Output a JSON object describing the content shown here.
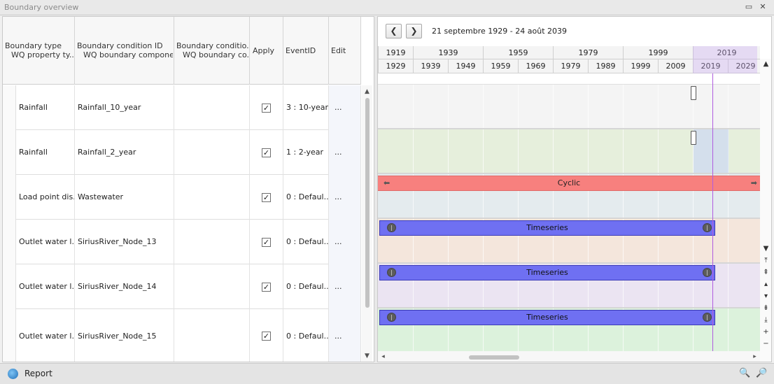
{
  "window": {
    "title": "Boundary overview",
    "restore_glyph": "▭",
    "close_glyph": "✕"
  },
  "grid": {
    "columns": [
      {
        "line1": "Boundary type",
        "line2": "WQ property ty..."
      },
      {
        "line1": "Boundary condition ID",
        "line2": "WQ boundary compone..."
      },
      {
        "line1": "Boundary conditio...",
        "line2": "WQ boundary co..."
      },
      {
        "line1": "Apply",
        "line2": ""
      },
      {
        "line1": "EventID",
        "line2": ""
      },
      {
        "line1": "Edit",
        "line2": ""
      }
    ],
    "rows": [
      {
        "type": "Rainfall",
        "id": "Rainfall_10_year",
        "cond": "",
        "apply": true,
        "event": "3 : 10-year",
        "edit": "..."
      },
      {
        "type": "Rainfall",
        "id": "Rainfall_2_year",
        "cond": "",
        "apply": true,
        "event": "1 : 2-year",
        "edit": "..."
      },
      {
        "type": "Load point dis...",
        "id": "Wastewater",
        "cond": "",
        "apply": true,
        "event": "0 : Defaul...",
        "edit": "..."
      },
      {
        "type": "Outlet water l...",
        "id": "SiriusRiver_Node_13",
        "cond": "",
        "apply": true,
        "event": "0 : Defaul...",
        "edit": "..."
      },
      {
        "type": "Outlet water l...",
        "id": "SiriusRiver_Node_14",
        "cond": "",
        "apply": true,
        "event": "0 : Defaul...",
        "edit": "..."
      },
      {
        "type": "Outlet water l...",
        "id": "SiriusRiver_Node_15",
        "cond": "",
        "apply": true,
        "event": "0 : Defaul...",
        "edit": "..."
      }
    ]
  },
  "timeline": {
    "prev_icon": "chevron-left",
    "next_icon": "chevron-right",
    "range_label": "21 septembre 1929 - 24 août 2039",
    "major_ticks": [
      "1919",
      "1939",
      "1959",
      "1979",
      "1999",
      "2019"
    ],
    "minor_ticks": [
      "1929",
      "1939",
      "1949",
      "1959",
      "1969",
      "1979",
      "1989",
      "1999",
      "2009",
      "2019",
      "2029"
    ],
    "bars": {
      "cyclic_label": "Cyclic",
      "timeseries_label": "Timeseries"
    },
    "lane_colors": [
      "#f4f4f4",
      "#e6efdc",
      "#e4ebee",
      "#f4e6dc",
      "#ebe4f2",
      "#dcf2dc"
    ]
  },
  "footer": {
    "report_label": "Report"
  }
}
